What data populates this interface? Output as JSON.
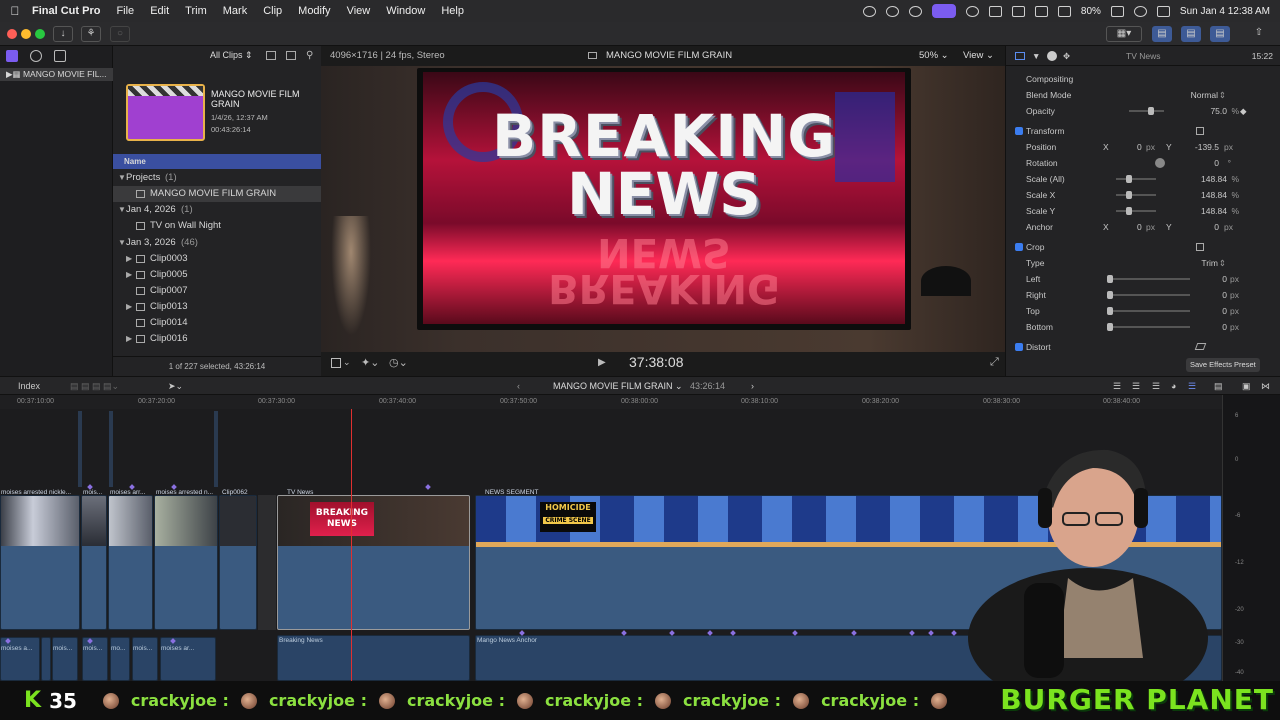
{
  "menubar": {
    "app": "Final Cut Pro",
    "items": [
      "File",
      "Edit",
      "Trim",
      "Mark",
      "Clip",
      "Modify",
      "View",
      "Window",
      "Help"
    ],
    "battery": "80%",
    "datetime": "Sun Jan 4  12:38 AM"
  },
  "browser": {
    "filter": "All Clips",
    "library": "MANGO MOVIE FIL...",
    "project_title": "MANGO MOVIE FILM GRAIN",
    "project_date": "1/4/26, 12:37 AM",
    "project_duration": "00:43:26:14",
    "column_name": "Name",
    "groups": [
      {
        "label": "Projects",
        "count": "(1)",
        "items": [
          "MANGO MOVIE FILM GRAIN"
        ]
      },
      {
        "label": "Jan 4, 2026",
        "count": "(1)",
        "items": [
          "TV on Wall Night"
        ]
      },
      {
        "label": "Jan 3, 2026",
        "count": "(46)",
        "items": [
          "Clip0003",
          "Clip0005",
          "Clip0007",
          "Clip0013",
          "Clip0014",
          "Clip0016"
        ]
      }
    ],
    "status": "1 of 227 selected, 43:26:14"
  },
  "viewer": {
    "format": "4096×1716 | 24 fps, Stereo",
    "title": "MANGO MOVIE FILM GRAIN",
    "zoom": "50%",
    "view_menu": "View",
    "headline_line1": "BREAKING",
    "headline_line2": "NEWS",
    "timecode": "37:38:08"
  },
  "inspector": {
    "clip_name": "TV News",
    "duration": "15:22",
    "compositing": "Compositing",
    "blend_mode_label": "Blend Mode",
    "blend_mode": "Normal",
    "opacity_label": "Opacity",
    "opacity": "75.0",
    "opacity_unit": "%",
    "transform": "Transform",
    "position_label": "Position",
    "position_x": "0",
    "position_y": "-139.5",
    "rotation_label": "Rotation",
    "rotation": "0",
    "scale_all_label": "Scale (All)",
    "scale_all": "148.84",
    "scale_x_label": "Scale X",
    "scale_x": "148.84",
    "scale_y_label": "Scale Y",
    "scale_y": "148.84",
    "anchor_label": "Anchor",
    "anchor_x": "0",
    "anchor_y": "0",
    "crop": "Crop",
    "crop_type_label": "Type",
    "crop_type": "Trim",
    "left_label": "Left",
    "left": "0",
    "right_label": "Right",
    "right": "0",
    "top_label": "Top",
    "top": "0",
    "bottom_label": "Bottom",
    "bottom": "0",
    "distort": "Distort",
    "save_preset": "Save Effects Preset",
    "px": "px",
    "pct": "%",
    "deg": "°",
    "x": "X",
    "y": "Y"
  },
  "timeline": {
    "index": "Index",
    "project": "MANGO MOVIE FILM GRAIN",
    "duration": "43:26:14",
    "ruler": [
      "00:37:10:00",
      "00:37:20:00",
      "00:37:30:00",
      "00:37:40:00",
      "00:37:50:00",
      "00:38:00:00",
      "00:38:10:00",
      "00:38:20:00",
      "00:38:30:00",
      "00:38:40:00"
    ],
    "clips": [
      "moises arrested nickle...",
      "mois...",
      "moises arr...",
      "moises arrested n...",
      "Clip0062",
      "TV News",
      "NEWS SEGMENT"
    ],
    "audio": [
      "moises a...",
      "mois...",
      "mois...",
      "mo...",
      "mois...",
      "moises ar...",
      "Breaking News",
      "Mango News Anchor"
    ],
    "thumb_homicide": "HOMICIDE",
    "thumb_crime": "CRIME SCENE",
    "meter_ticks": [
      "6",
      "0",
      "-6",
      "-12",
      "-20",
      "-30",
      "-40"
    ]
  },
  "stream": {
    "count_letter": "K",
    "count": "35",
    "chat_user": "crackyjoe :",
    "brand": "BURGER PLANET"
  }
}
